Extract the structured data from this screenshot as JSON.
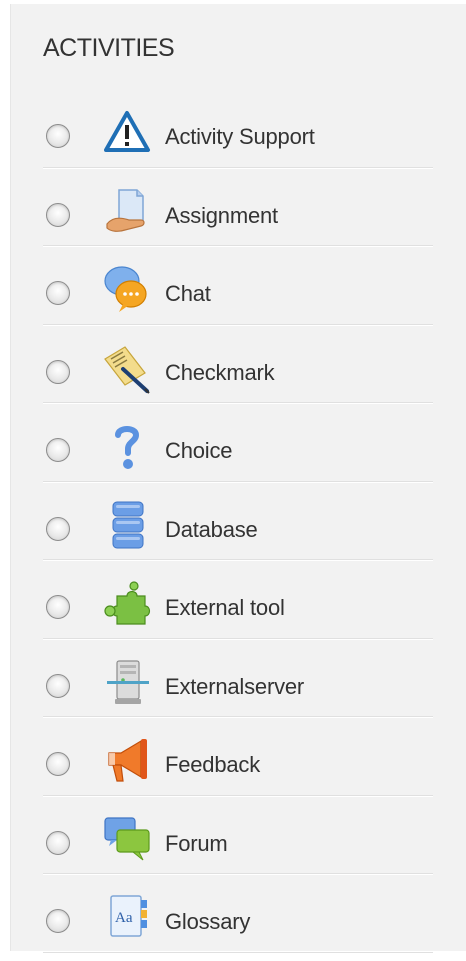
{
  "section": {
    "title": "ACTIVITIES"
  },
  "items": [
    {
      "label": "Activity Support",
      "icon": "warning-triangle-icon"
    },
    {
      "label": "Assignment",
      "icon": "assignment-icon"
    },
    {
      "label": "Chat",
      "icon": "chat-bubbles-icon"
    },
    {
      "label": "Checkmark",
      "icon": "checkmark-pen-icon"
    },
    {
      "label": "Choice",
      "icon": "question-mark-icon"
    },
    {
      "label": "Database",
      "icon": "database-icon"
    },
    {
      "label": "External tool",
      "icon": "puzzle-piece-icon"
    },
    {
      "label": "Externalserver",
      "icon": "server-icon"
    },
    {
      "label": "Feedback",
      "icon": "megaphone-icon"
    },
    {
      "label": "Forum",
      "icon": "forum-bubbles-icon"
    },
    {
      "label": "Glossary",
      "icon": "glossary-book-icon"
    }
  ],
  "colors": {
    "panel_bg": "#f2f2f2",
    "text": "#333333",
    "divider": "#e0e0e0"
  }
}
